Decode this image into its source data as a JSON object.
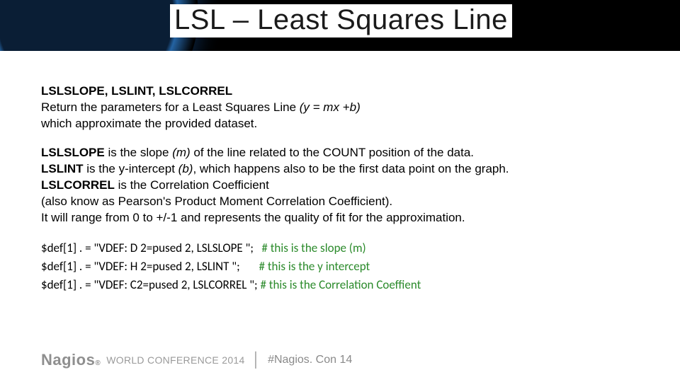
{
  "header": {
    "title": "LSL – Least Squares Line"
  },
  "section1": {
    "heading": "LSLSLOPE, LSLINT, LSLCORREL",
    "line1a": "Return the parameters for a Least Squares Line ",
    "line1b": "(y = mx +b)",
    "line2": "which approximate the provided dataset."
  },
  "section2": {
    "l1a": "LSLSLOPE",
    "l1b": " is the slope ",
    "l1c": "(m)",
    "l1d": " of the line related to the COUNT position of the data.",
    "l2a": "LSLINT",
    "l2b": " is the y-intercept ",
    "l2c": "(b)",
    "l2d": ", which happens also to be the first data point on the graph.",
    "l3a": "LSLCORREL",
    "l3b": " is the Correlation Coefficient",
    "l4": "(also know as Pearson's Product Moment Correlation Coefficient).",
    "l5": "It will range from 0 to +/-1 and represents the quality of fit for the approximation."
  },
  "code": {
    "l1": "$def[1] . = \"VDEF: D 2=pused 2, LSLSLOPE \"; ",
    "c1": "  # this is the slope (m)",
    "l2": "$def[1] . = \"VDEF: H 2=pused 2, LSLINT \"; ",
    "c2": "      # this is the y intercept",
    "l3": "$def[1] . = \"VDEF: C2=pused 2, LSLCORREL \"; ",
    "c3": "# this is the Correlation Coeffient"
  },
  "footer": {
    "logo": "Nagios",
    "reg": "®",
    "conf": "WORLD CONFERENCE 2014",
    "pipe": "│",
    "hashtag": "#Nagios. Con 14"
  }
}
